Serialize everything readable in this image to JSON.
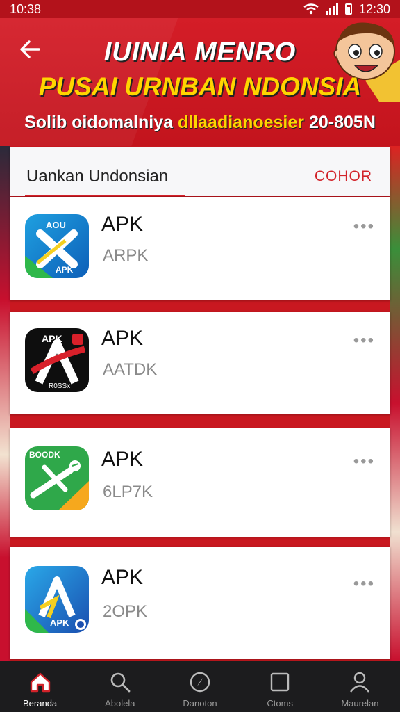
{
  "status_bar": {
    "time": "10:38",
    "time_right": "12:30"
  },
  "banner": {
    "line1": "IUINIA MENRO",
    "line2": "PUSAI URNBAN NDONSIA",
    "line3_a": "Solib oidomalniya",
    "line3_b": "dllaadianoesier",
    "line3_c": "20-805N"
  },
  "section": {
    "title": "Uankan Undonsian",
    "action": "COHOR"
  },
  "apps": [
    {
      "name": "APK",
      "subtitle": "ARPK",
      "icon_text_top": "AOU",
      "icon_text_bottom": "APK",
      "icon": "app-icon-blue-x"
    },
    {
      "name": "APK",
      "subtitle": "AATDK",
      "icon_text_top": "APK",
      "icon_text_bottom": "R0SSx",
      "icon": "app-icon-black-a"
    },
    {
      "name": "APK",
      "subtitle": "6LP7K",
      "icon_text_top": "BOODK",
      "icon_text_bottom": "",
      "icon": "app-icon-green-plane"
    },
    {
      "name": "APK",
      "subtitle": "2OPK",
      "icon_text_top": "",
      "icon_text_bottom": "APK",
      "icon": "app-icon-blue-a"
    }
  ],
  "more_label": "•••",
  "bottom_nav": [
    {
      "label": "Beranda",
      "icon": "home-icon"
    },
    {
      "label": "Abolela",
      "icon": "search-icon"
    },
    {
      "label": "Danoton",
      "icon": "compass-icon"
    },
    {
      "label": "Ctoms",
      "icon": "square-icon"
    },
    {
      "label": "Maurelan",
      "icon": "profile-icon"
    }
  ],
  "colors": {
    "brand_red": "#c91820",
    "accent_yellow": "#ffd400",
    "nav_bg": "#1c1c1e"
  }
}
